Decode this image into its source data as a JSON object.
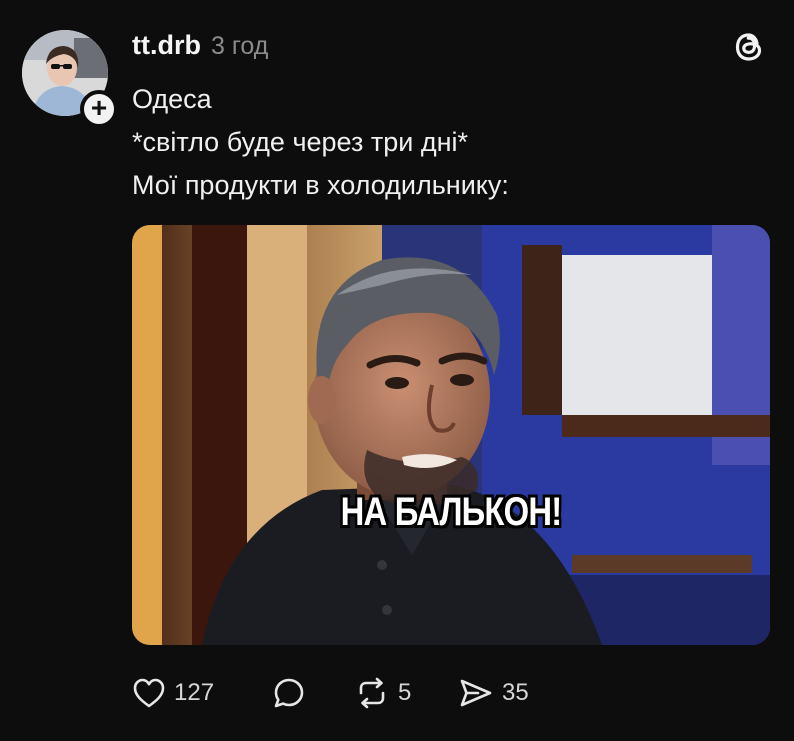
{
  "post": {
    "author": "tt.drb",
    "time": "3 год",
    "lines": [
      "Одеса",
      "*світло буде через три дні*",
      "Мої продукти в холодильнику:"
    ],
    "media": {
      "caption": "НА БАЛЬКОН!"
    }
  },
  "actions": {
    "likes": "127",
    "reposts": "5",
    "shares": "35"
  },
  "icons": {
    "like": "heart-icon",
    "comment": "comment-bubble-icon",
    "repost": "repost-icon",
    "share": "send-icon",
    "app": "threads-logo-icon",
    "follow": "plus-icon"
  },
  "colors": {
    "background": "#0d0d0d",
    "text": "#f3f3f3",
    "muted": "#8b8b8b"
  }
}
